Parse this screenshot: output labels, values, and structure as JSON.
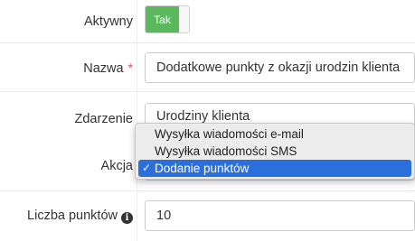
{
  "form": {
    "active": {
      "label": "Aktywny",
      "toggle_text": "Tak",
      "value": true
    },
    "name": {
      "label": "Nazwa",
      "required_mark": "*",
      "value": "Dodatkowe punkty z okazji urodzin klienta"
    },
    "event": {
      "label": "Zdarzenie",
      "value": "Urodziny klienta"
    },
    "action": {
      "label": "Akcja",
      "options": [
        "Wysyłka wiadomości e-mail",
        "Wysyłka wiadomości SMS",
        "Dodanie punktów"
      ],
      "selected": "Dodanie punktów",
      "check_glyph": "✓"
    },
    "points": {
      "label": "Liczba punktów",
      "info_glyph": "i",
      "value": "10"
    }
  },
  "colors": {
    "toggle_on": "#5cb85c",
    "required": "#d9534f",
    "selection": "#2a6fdb"
  }
}
